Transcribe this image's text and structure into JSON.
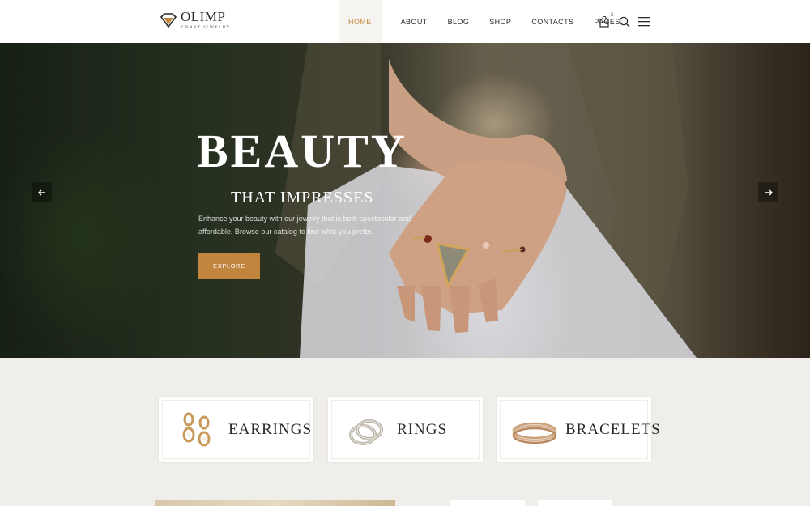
{
  "brand": {
    "name": "OLIMP",
    "tagline": "CRAFT JEWELRY",
    "accent": "#c2853e"
  },
  "nav": {
    "items": [
      {
        "label": "HOME",
        "active": true
      },
      {
        "label": "ABOUT"
      },
      {
        "label": "BLOG"
      },
      {
        "label": "SHOP"
      },
      {
        "label": "CONTACTS"
      },
      {
        "label": "PAGES"
      }
    ],
    "cart_count": "2",
    "icons": [
      "shopping-bag-icon",
      "search-icon",
      "menu-icon"
    ]
  },
  "hero": {
    "title": "BEAUTY",
    "subtitle": "THAT IMPRESSES",
    "description": "Enhance your beauty with our jewelry that is both spectacular and affordable. Browse our catalog to find what you prefer.",
    "button": "EXPLORE",
    "prev_icon": "arrow-left-icon",
    "next_icon": "arrow-right-icon"
  },
  "categories": [
    {
      "label": "EARRINGS",
      "icon": "earrings-icon"
    },
    {
      "label": "RINGS",
      "icon": "rings-icon"
    },
    {
      "label": "BRACELETS",
      "icon": "bracelets-icon"
    }
  ]
}
